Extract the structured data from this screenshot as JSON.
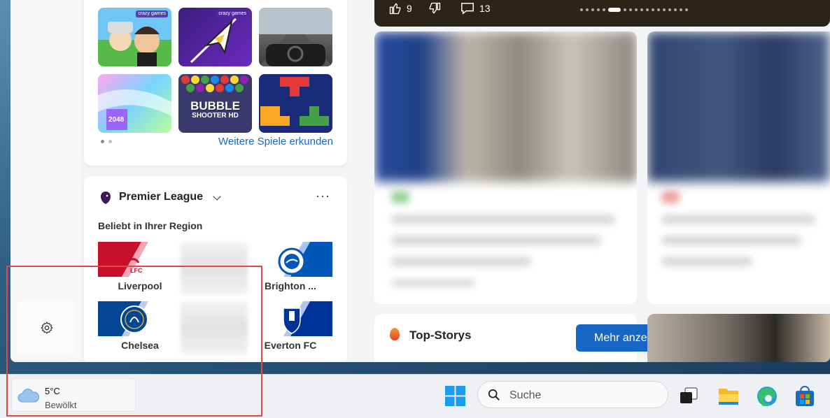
{
  "hero": {
    "likes": "9",
    "comments": "13"
  },
  "games": {
    "brand": "crazy games",
    "more_link": "Weitere Spiele erkunden",
    "tiles": [
      "2048",
      "BUBBLE",
      "SHOOTER HD"
    ]
  },
  "premier_league": {
    "title": "Premier League",
    "region_label": "Beliebt in Ihrer Region",
    "teams": [
      "Liverpool",
      "Brighton ...",
      "Chelsea",
      "Everton FC"
    ],
    "crests": {
      "liverpool": "LFC"
    },
    "colors": {
      "liverpool": "#c8102e",
      "brighton": "#0057b8",
      "chelsea": "#034694",
      "everton": "#003399"
    }
  },
  "top_stories": {
    "title": "Top-Storys",
    "button": "Mehr anzeigen"
  },
  "taskbar": {
    "temperature": "5°C",
    "condition": "Bewölkt",
    "search_placeholder": "Suche",
    "icons": [
      "windows-start-icon",
      "search-icon",
      "task-view-icon",
      "file-explorer-icon",
      "edge-icon",
      "store-icon"
    ]
  },
  "colors": {
    "accent": "#1667c5",
    "highlight": "#e04a43"
  }
}
